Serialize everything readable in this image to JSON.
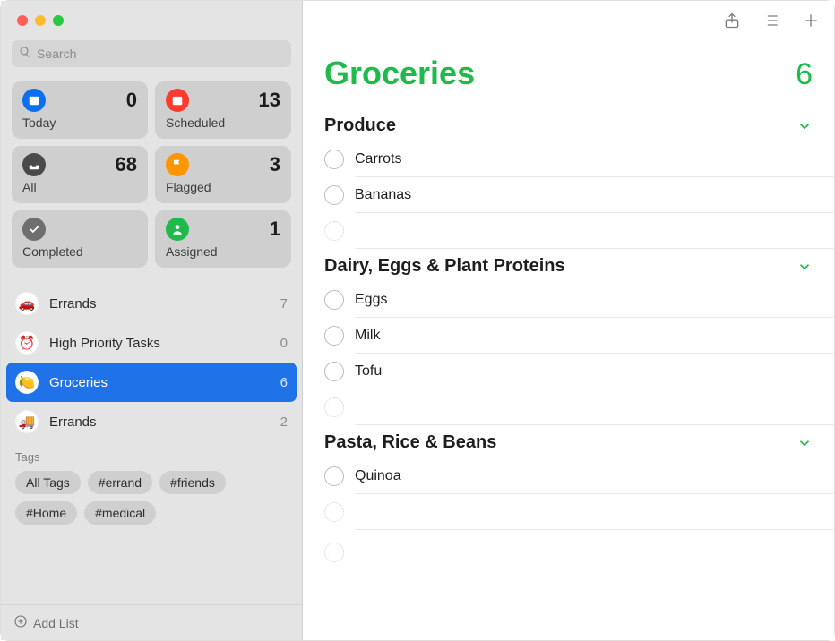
{
  "search": {
    "placeholder": "Search"
  },
  "smart": {
    "today": {
      "label": "Today",
      "count": 0,
      "color": "#0a6ff0"
    },
    "scheduled": {
      "label": "Scheduled",
      "count": 13,
      "color": "#ff3b30"
    },
    "all": {
      "label": "All",
      "count": 68,
      "color": "#4a4a4a"
    },
    "flagged": {
      "label": "Flagged",
      "count": 3,
      "color": "#ff9500"
    },
    "completed": {
      "label": "Completed",
      "count": "",
      "color": "#6e6e6e"
    },
    "assigned": {
      "label": "Assigned",
      "count": 1,
      "color": "#1fb94c"
    }
  },
  "lists": [
    {
      "emoji": "🚗",
      "name": "Errands",
      "count": 7,
      "selected": false
    },
    {
      "emoji": "⏰",
      "name": "High Priority Tasks",
      "count": 0,
      "selected": false
    },
    {
      "emoji": "🍋",
      "name": "Groceries",
      "count": 6,
      "selected": true
    },
    {
      "emoji": "🚚",
      "name": "Errands",
      "count": 2,
      "selected": false
    }
  ],
  "tagsHeader": "Tags",
  "tags": [
    "All Tags",
    "#errand",
    "#friends",
    "#Home",
    "#medical"
  ],
  "addList": "Add List",
  "current": {
    "title": "Groceries",
    "total": 6,
    "sections": [
      {
        "title": "Produce",
        "items": [
          "Carrots",
          "Bananas"
        ]
      },
      {
        "title": "Dairy, Eggs & Plant Proteins",
        "items": [
          "Eggs",
          "Milk",
          "Tofu"
        ]
      },
      {
        "title": "Pasta, Rice & Beans",
        "items": [
          "Quinoa"
        ]
      }
    ]
  }
}
